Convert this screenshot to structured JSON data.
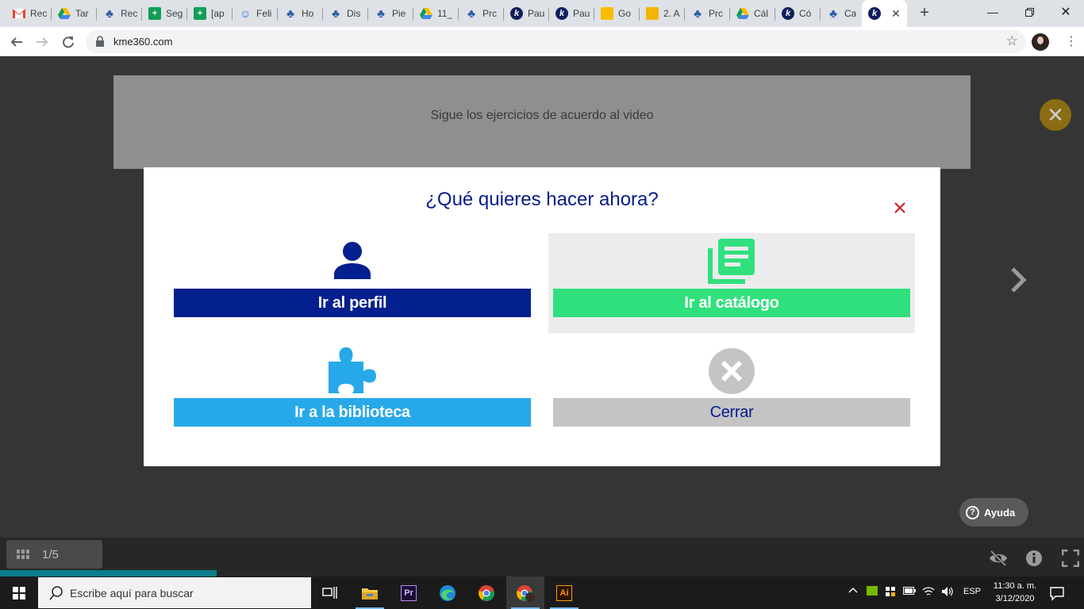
{
  "browser": {
    "tabs": [
      {
        "label": "Rec",
        "icon": "gmail-icon",
        "color": "#ea4335"
      },
      {
        "label": "Tar",
        "icon": "drive-icon",
        "color": "#1a73e8"
      },
      {
        "label": "Rec",
        "icon": "tree-icon",
        "color": "#2b5fa8"
      },
      {
        "label": "Seg",
        "icon": "sheets-icon",
        "color": "#0f9d58"
      },
      {
        "label": "[ap",
        "icon": "sheets-icon",
        "color": "#0f9d58"
      },
      {
        "label": "Feli",
        "icon": "bot-icon",
        "color": "#1a73e8"
      },
      {
        "label": "Ho",
        "icon": "tree-icon",
        "color": "#2b5fa8"
      },
      {
        "label": "Dis",
        "icon": "tree-icon",
        "color": "#2b5fa8"
      },
      {
        "label": "Pie",
        "icon": "tree-icon",
        "color": "#2b5fa8"
      },
      {
        "label": "11_",
        "icon": "drive-icon",
        "color": "#1a73e8"
      },
      {
        "label": "Prc",
        "icon": "tree-icon",
        "color": "#2b5fa8"
      },
      {
        "label": "Pau",
        "icon": "k-icon",
        "color": "#0d1f5c"
      },
      {
        "label": "Pau",
        "icon": "k-icon",
        "color": "#0d1f5c"
      },
      {
        "label": "Go",
        "icon": "keep-icon",
        "color": "#fbbc04"
      },
      {
        "label": "2. A",
        "icon": "slides-icon",
        "color": "#f4b400"
      },
      {
        "label": "Prc",
        "icon": "tree-icon",
        "color": "#2b5fa8"
      },
      {
        "label": "Cál",
        "icon": "drive-icon",
        "color": "#1a73e8"
      },
      {
        "label": "Có",
        "icon": "k-icon",
        "color": "#0d1f5c"
      },
      {
        "label": "Ca",
        "icon": "tree-icon",
        "color": "#2b5fa8"
      }
    ],
    "url": "kme360.com"
  },
  "slide": {
    "text": "Sigue los ejercicios de acuerdo al video"
  },
  "modal": {
    "title": "¿Qué quieres hacer ahora?",
    "options": [
      {
        "label": "Ir al perfil",
        "icon": "person-icon",
        "color": "#04208f"
      },
      {
        "label": "Ir al catálogo",
        "icon": "catalog-icon",
        "color": "#30e07d"
      },
      {
        "label": "Ir a la biblioteca",
        "icon": "puzzle-icon",
        "color": "#27a9e9"
      },
      {
        "label": "Cerrar",
        "icon": "close-circle-icon",
        "color": "#c4c4c4"
      }
    ]
  },
  "help": {
    "label": "Ayuda"
  },
  "player": {
    "page_indicator": "1/5",
    "progress": 0.2
  },
  "taskbar": {
    "search_placeholder": "Escribe aquí para buscar",
    "language": "ESP",
    "time": "11:30 a. m.",
    "date": "3/12/2020"
  }
}
